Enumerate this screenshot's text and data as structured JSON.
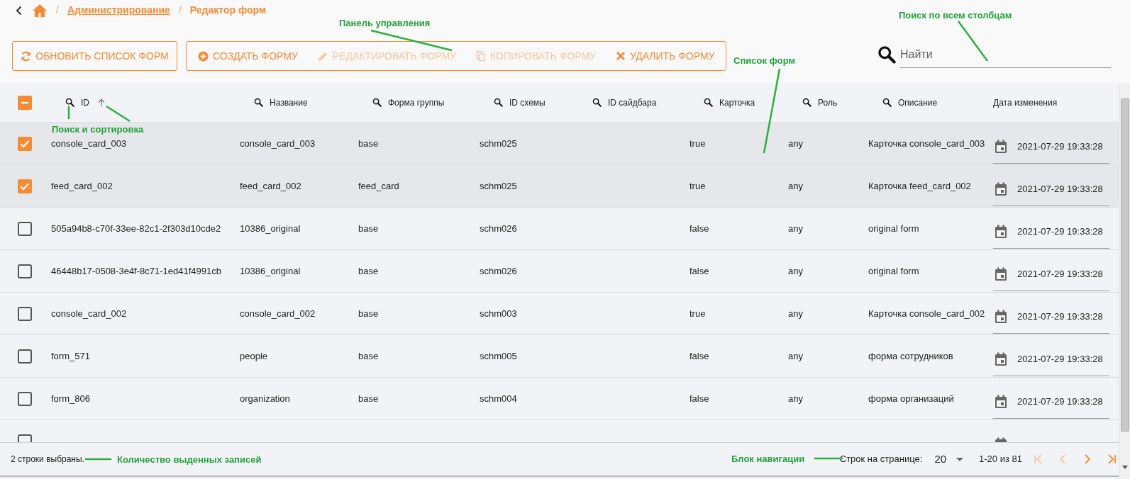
{
  "breadcrumbs": [
    {
      "separator": "/",
      "label": "Администрирование",
      "link": true
    },
    {
      "separator": "/",
      "label": "Редактор форм",
      "link": false
    }
  ],
  "refresh_button": {
    "label": "ОБНОВИТЬ СПИСОК ФОРМ",
    "kind": "refresh",
    "disabled": false
  },
  "toolbar": [
    {
      "label": "СОЗДАТЬ ФОРМУ",
      "kind": "create",
      "disabled": false
    },
    {
      "label": "РЕДАКТИРОВАТЬ ФОРМУ",
      "kind": "edit",
      "disabled": true
    },
    {
      "label": "КОПИРОВАТЬ ФОРМУ",
      "kind": "copy",
      "disabled": true
    },
    {
      "label": "УДАЛИТЬ ФОРМУ",
      "kind": "delete",
      "disabled": false
    }
  ],
  "search": {
    "placeholder": "Найти"
  },
  "table": {
    "select_all": {
      "indeterminate": true
    },
    "columns": [
      {
        "label": "ID",
        "searchable": true,
        "sorted_ascending": true
      },
      {
        "label": "Название",
        "searchable": true
      },
      {
        "label": "Форма группы",
        "searchable": true
      },
      {
        "label": "ID схемы",
        "searchable": true
      },
      {
        "label": "ID сайдбара",
        "searchable": true
      },
      {
        "label": "Карточка",
        "searchable": true
      },
      {
        "label": "Роль",
        "searchable": true
      },
      {
        "label": "Описание",
        "searchable": true
      },
      {
        "label": "Дата изменения",
        "searchable": false
      }
    ],
    "rows": [
      {
        "selected": true,
        "id": "console_card_003",
        "name": "console_card_003",
        "group_form": "base",
        "schema_id": "schm025",
        "card": "true",
        "role": "any",
        "description": "Карточка console_card_003",
        "modified": "2021-07-29 19:33:28"
      },
      {
        "selected": true,
        "id": "feed_card_002",
        "name": "feed_card_002",
        "group_form": "feed_card",
        "schema_id": "schm025",
        "card": "true",
        "role": "any",
        "description": "Карточка feed_card_002",
        "modified": "2021-07-29 19:33:28"
      },
      {
        "selected": false,
        "id": "505a94b8-c70f-33ee-82c1-2f303d10cde2",
        "name": "10386_original",
        "group_form": "base",
        "schema_id": "schm026",
        "card": "false",
        "role": "any",
        "description": "original form",
        "modified": "2021-07-29 19:33:28"
      },
      {
        "selected": false,
        "id": "46448b17-0508-3e4f-8c71-1ed41f4991cb",
        "name": "10386_original",
        "group_form": "base",
        "schema_id": "schm026",
        "card": "false",
        "role": "any",
        "description": "original form",
        "modified": "2021-07-29 19:33:28"
      },
      {
        "selected": false,
        "id": "console_card_002",
        "name": "console_card_002",
        "group_form": "base",
        "schema_id": "schm003",
        "card": "true",
        "role": "any",
        "description": "Карточка console_card_002",
        "modified": "2021-07-29 19:33:28"
      },
      {
        "selected": false,
        "id": "form_571",
        "name": "people",
        "group_form": "base",
        "schema_id": "schm005",
        "card": "false",
        "role": "any",
        "description": "форма сотрудников",
        "modified": "2021-07-29 19:33:28"
      },
      {
        "selected": false,
        "id": "form_806",
        "name": "organization",
        "group_form": "base",
        "schema_id": "schm004",
        "card": "false",
        "role": "any",
        "description": "форма организаций",
        "modified": "2021-07-29 19:33:28"
      },
      {
        "selected": false
      }
    ]
  },
  "footer": {
    "selection": "2 строки выбраны.",
    "rows_per_page_label": "Строк на странице:",
    "rows_per_page": "20",
    "range": "1-20 из 81",
    "nav": [
      {
        "kind": "first",
        "disabled": true
      },
      {
        "kind": "previous",
        "disabled": true
      },
      {
        "kind": "next",
        "disabled": false
      },
      {
        "kind": "last",
        "disabled": false
      }
    ]
  },
  "annotations": [
    {
      "text": "Панель управления"
    },
    {
      "text": "Поиск по всем столбцам"
    },
    {
      "text": "Список форм"
    },
    {
      "text": "Поиск и сортировка"
    },
    {
      "text": "Количество выденных записей"
    },
    {
      "text": "Блок навигации"
    }
  ]
}
